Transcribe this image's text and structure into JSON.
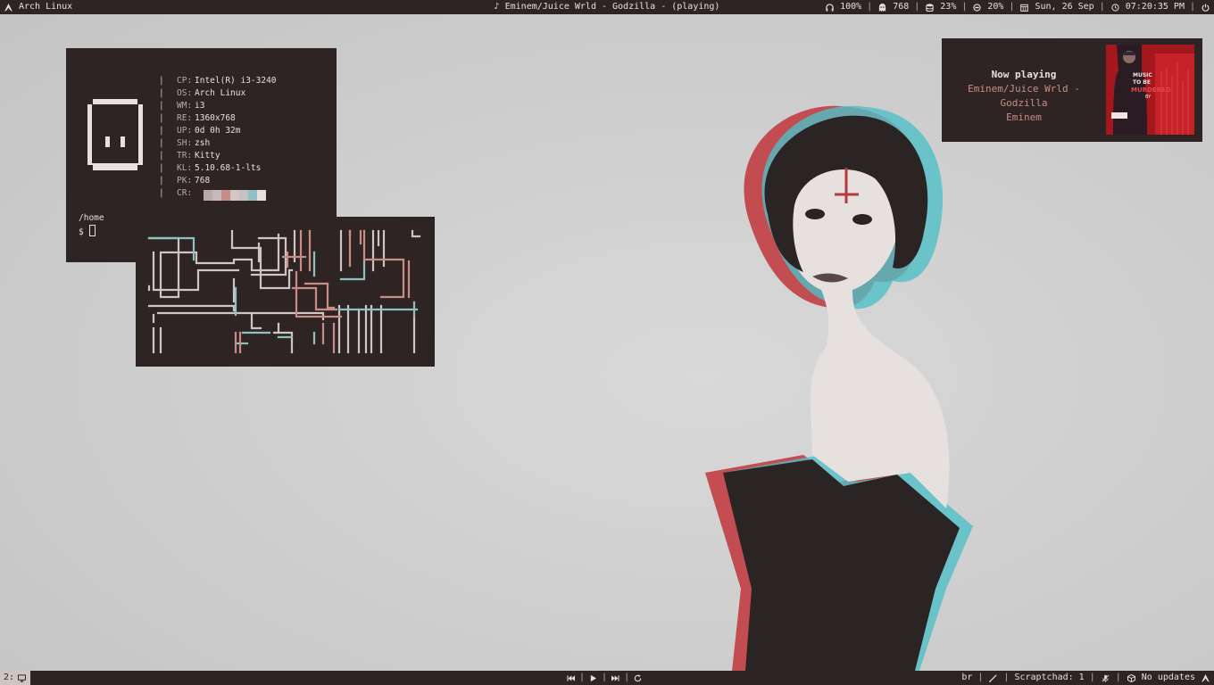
{
  "topbar": {
    "distro": "Arch Linux",
    "media_status": "Eminem/Juice Wrld - Godzilla - (playing)",
    "volume": "100%",
    "packages": "768",
    "disk": "23%",
    "cpu": "20%",
    "date": "Sun, 26 Sep",
    "time": "07:20:35 PM"
  },
  "fetch": {
    "rows": [
      {
        "key": "CP:",
        "value": "Intel(R) i3-3240"
      },
      {
        "key": "OS:",
        "value": "Arch Linux"
      },
      {
        "key": "WM:",
        "value": "i3"
      },
      {
        "key": "RE:",
        "value": "1360x768"
      },
      {
        "key": "UP:",
        "value": "0d 0h 32m"
      },
      {
        "key": "SH:",
        "value": "zsh"
      },
      {
        "key": "TR:",
        "value": "Kitty"
      },
      {
        "key": "KL:",
        "value": "5.10.68-1-lts"
      },
      {
        "key": "PK:",
        "value": "768"
      },
      {
        "key": "CR:",
        "value": ""
      }
    ],
    "bar_char": "|",
    "palette": [
      "#b8a9ad",
      "#c8b8bb",
      "#c98d87",
      "#d4c6c4",
      "#c6c2c2",
      "#8fc1c3",
      "#e8e0dc"
    ],
    "cwd": "/home",
    "prompt_symbol": "$"
  },
  "now_playing": {
    "title": "Now playing",
    "track": "Eminem/Juice Wrld - Godzilla",
    "artist": "Eminem",
    "cover_text": "MUSIC TO BE MURDERED BY"
  },
  "bottombar": {
    "workspace": "2:",
    "keyboard_layout": "br",
    "scratchpad": "Scraptchad: 1",
    "updates": "No updates"
  },
  "colors": {
    "bar_bg": "#2f2424",
    "fg": "#e8e0dc",
    "accent_red": "#c98d87",
    "accent_cyan": "#8fc1c3"
  }
}
